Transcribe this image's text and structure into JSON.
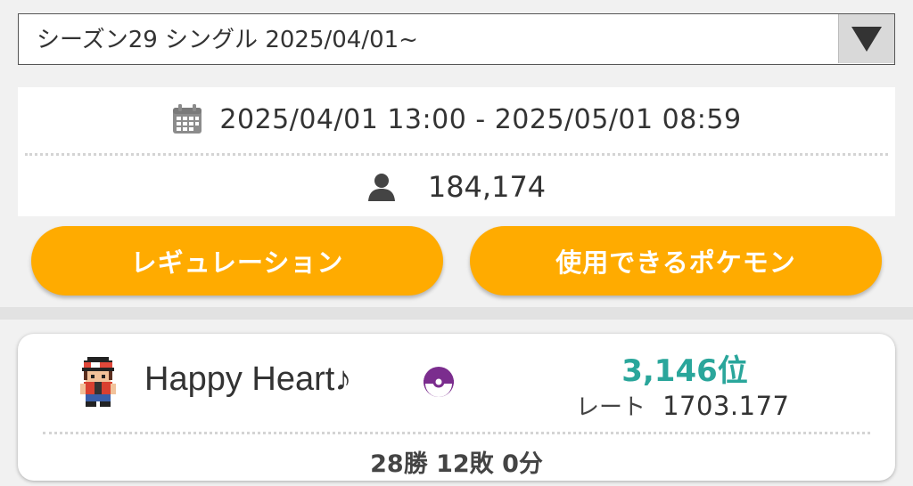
{
  "season_select": {
    "selected": "シーズン29 シングル 2025/04/01~"
  },
  "info": {
    "period": "2025/04/01 13:00 - 2025/05/01 08:59",
    "players": "184,174"
  },
  "buttons": {
    "regulation": "レギュレーション",
    "usable_pokemon": "使用できるポケモン"
  },
  "player": {
    "name": "Happy Heart♪",
    "rank": "3,146位",
    "rate_label": "レート",
    "rate_value": "1703.177",
    "record": "28勝 12敗 0分"
  },
  "colors": {
    "accent_orange": "#ffab00",
    "rank_teal": "#2aa69b",
    "ball_purple": "#7b2d8e"
  },
  "icons": [
    "calendar-icon",
    "person-icon",
    "dropdown-arrow-icon",
    "trainer-sprite-icon",
    "poke-ball-icon"
  ]
}
